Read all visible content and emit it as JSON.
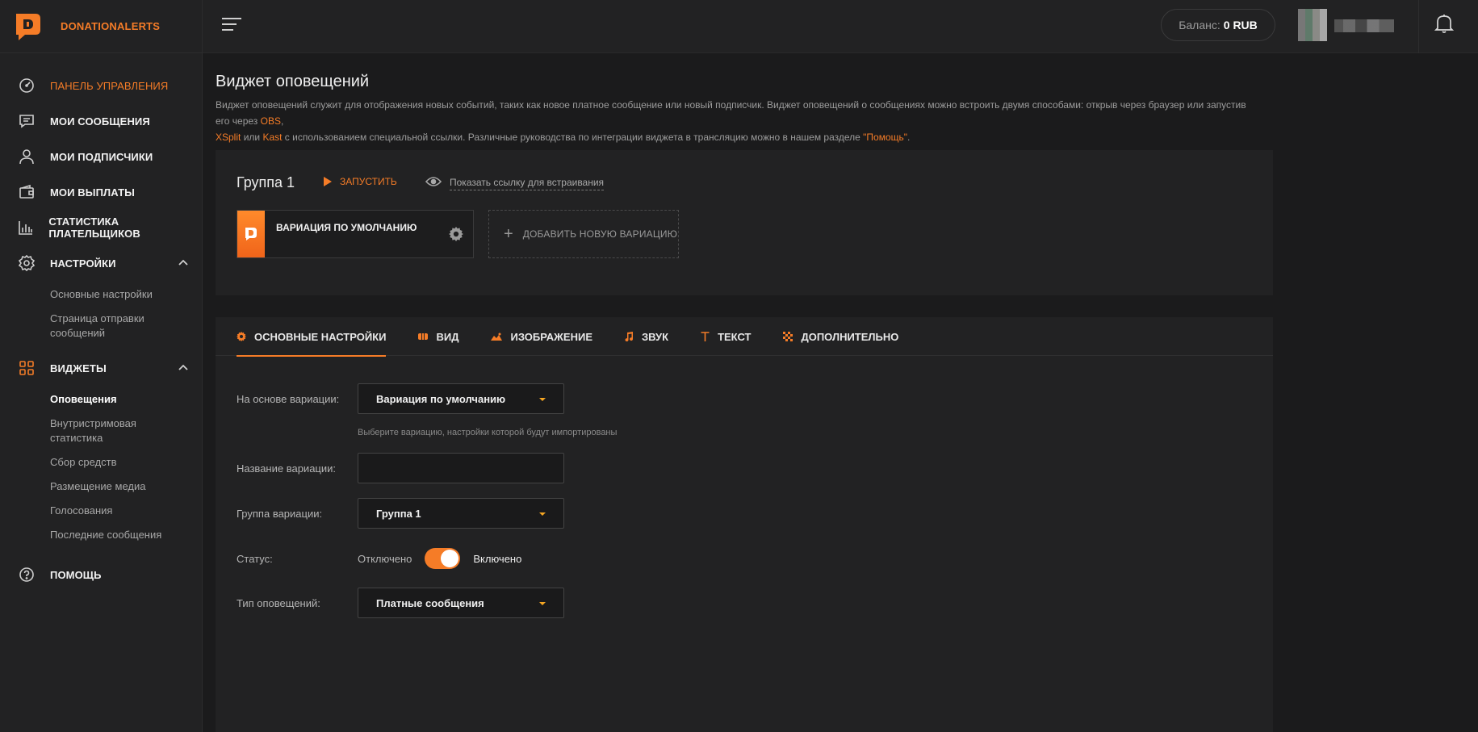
{
  "brand": {
    "name": "DONATIONALERTS",
    "accent": "#f57c27"
  },
  "sidebar": {
    "items": [
      {
        "label": "Панель управления",
        "icon": "dashboard-icon",
        "active": true
      },
      {
        "label": "Мои сообщения",
        "icon": "messages-icon"
      },
      {
        "label": "Мои подписчики",
        "icon": "user-icon"
      },
      {
        "label": "Мои выплаты",
        "icon": "wallet-icon"
      },
      {
        "label": "Статистика плательщиков",
        "icon": "stats-icon"
      },
      {
        "label": "Настройки",
        "icon": "gear-icon"
      },
      {
        "label": "Виджеты",
        "icon": "widgets-icon"
      },
      {
        "label": "Помощь",
        "icon": "help-icon"
      }
    ],
    "settings_sub": [
      "Основные настройки",
      "Страница отправки сообщений"
    ],
    "widgets_sub": [
      "Оповещения",
      "Внутристримовая статистика",
      "Сбор средств",
      "Размещение медиа",
      "Голосования",
      "Последние сообщения"
    ]
  },
  "topbar": {
    "balance_label": "Баланс:",
    "balance_value": "0 RUB"
  },
  "page": {
    "title": "Виджет оповещений",
    "desc_1": "Виджет оповещений служит для отображения новых событий, таких как новое платное сообщение или новый подписчик. Виджет оповещений о сообщениях можно встроить двумя способами: открыв через браузер или запустив его через ",
    "desc_obs": "OBS",
    "desc_comma": ",",
    "desc_xsplit": "XSplit",
    "desc_or": " или ",
    "desc_kast": "Kast",
    "desc_2": " с использованием специальной ссылки. Различные руководства по интеграции виджета в трансляцию можно в нашем разделе ",
    "desc_help": "\"Помощь\"",
    "desc_end": "."
  },
  "group": {
    "name": "Группа 1",
    "launch": "ЗАПУСТИТЬ",
    "embed_link": "Показать ссылку для встраивания",
    "variation_name": "ВАРИАЦИЯ ПО УМОЛЧАНИЮ",
    "add_variation": "ДОБАВИТЬ НОВУЮ ВАРИАЦИЮ"
  },
  "tabs": [
    {
      "label": "ОСНОВНЫЕ НАСТРОЙКИ",
      "icon": "gear-icon",
      "active": true
    },
    {
      "label": "ВИД",
      "icon": "view-icon"
    },
    {
      "label": "ИЗОБРАЖЕНИЕ",
      "icon": "image-icon"
    },
    {
      "label": "ЗВУК",
      "icon": "music-note-icon"
    },
    {
      "label": "ТЕКСТ",
      "icon": "text-icon"
    },
    {
      "label": "ДОПОЛНИТЕЛЬНО",
      "icon": "grid-icon"
    }
  ],
  "form": {
    "based_on_label": "На основе вариации:",
    "based_on_value": "Вариация по умолчанию",
    "based_on_hint": "Выберите вариацию, настройки которой будут импортированы",
    "name_label": "Название вариации:",
    "name_value": "",
    "group_label": "Группа вариации:",
    "group_value": "Группа 1",
    "status_label": "Статус:",
    "status_off": "Отключено",
    "status_on": "Включено",
    "status_enabled": true,
    "type_label": "Тип оповещений:",
    "type_value": "Платные сообщения"
  }
}
